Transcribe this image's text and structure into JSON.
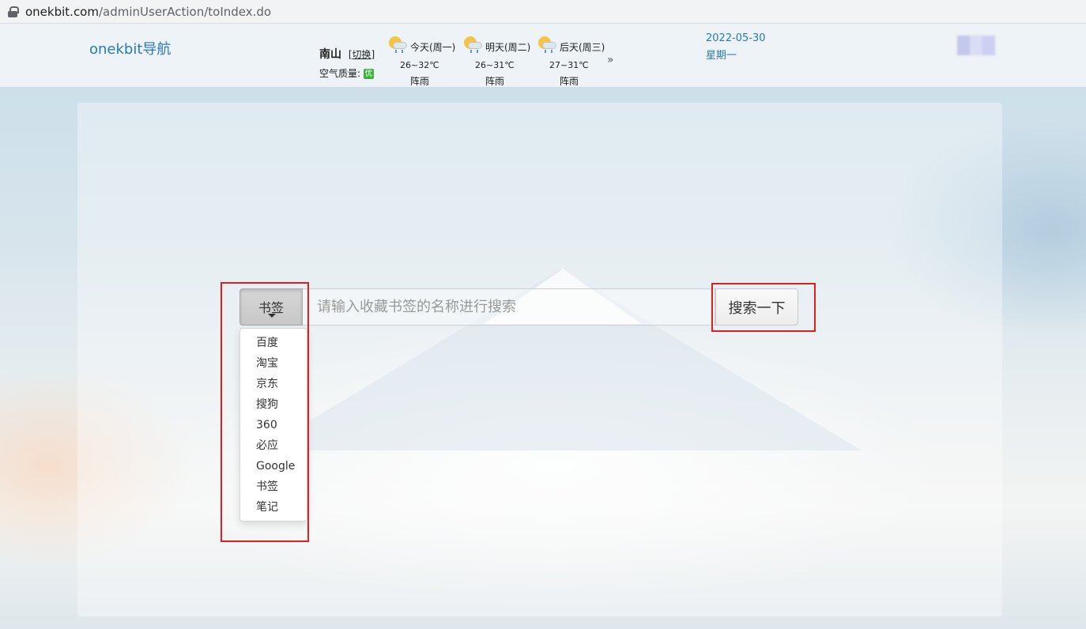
{
  "browser": {
    "url_host": "onekbit.com",
    "url_path": "/adminUserAction/toIndex.do"
  },
  "header": {
    "brand": "onekbit导航",
    "weather": {
      "city": "南山",
      "switch_label": "[切换]",
      "air_quality_label": "空气质量:",
      "air_quality_badge": "优",
      "days": [
        {
          "label": "今天(周一)",
          "temp": "26~32℃",
          "condition": "阵雨",
          "icon": "sun-cloud-rain-icon"
        },
        {
          "label": "明天(周二)",
          "temp": "26~31℃",
          "condition": "阵雨",
          "icon": "sun-cloud-rain-icon"
        },
        {
          "label": "后天(周三)",
          "temp": "27~31℃",
          "condition": "阵雨",
          "icon": "sun-cloud-rain-icon"
        }
      ],
      "more_icon": "double-chevron-right-icon",
      "more_glyph": "»"
    },
    "date": "2022-05-30",
    "weekday": "星期一"
  },
  "search": {
    "engine_selected": "书签",
    "placeholder": "请输入收藏书签的名称进行搜索",
    "submit_label": "搜索一下",
    "engine_options": [
      "百度",
      "淘宝",
      "京东",
      "搜狗",
      "360",
      "必应",
      "Google",
      "书签",
      "笔记"
    ]
  },
  "colors": {
    "brand": "#2a7bb5",
    "annotation": "#e02020",
    "air_quality_good": "#3cb03c"
  }
}
